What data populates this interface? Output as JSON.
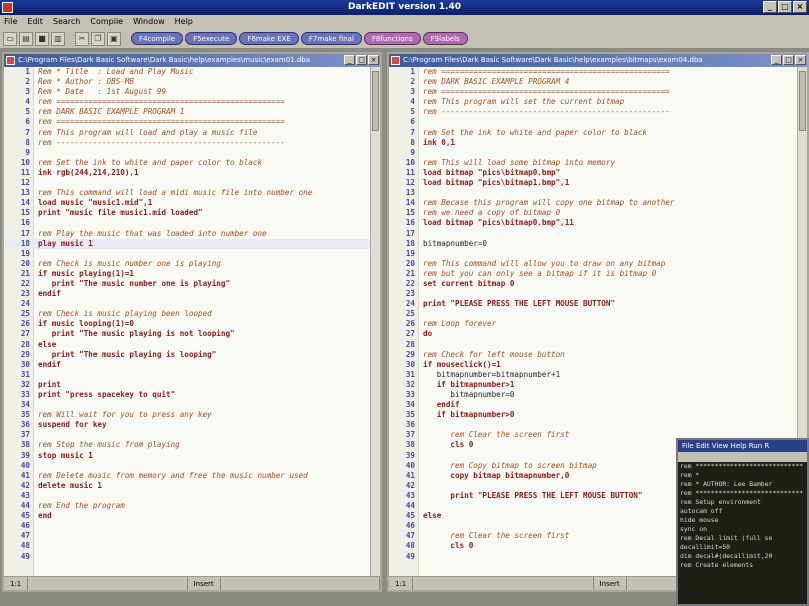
{
  "app": {
    "title": "DarkEDIT version 1.40"
  },
  "menu": [
    "File",
    "Edit",
    "Search",
    "Compile",
    "Window",
    "Help"
  ],
  "function_keys": [
    {
      "label": "F4compile",
      "style": "blue"
    },
    {
      "label": "F5execute",
      "style": "blue"
    },
    {
      "label": "F6make EXE",
      "style": "blue"
    },
    {
      "label": "F7make final",
      "style": "blue"
    },
    {
      "label": "F8functions",
      "style": "pink"
    },
    {
      "label": "F9labels",
      "style": "pink"
    }
  ],
  "left_pane": {
    "title": "C:\\Program Files\\Dark Basic Software\\Dark Basic\\help\\examples\\music\\exam01.dba",
    "status": {
      "position": "1:1",
      "mode": "Insert"
    },
    "lines": [
      {
        "n": "1",
        "t": "Rem * Title  : Load and Play Music",
        "k": "rem"
      },
      {
        "n": "2",
        "t": "Rem * Author : DBS-MB",
        "k": "rem"
      },
      {
        "n": "3",
        "t": "Rem * Date   : 1st August 99",
        "k": "rem"
      },
      {
        "n": "4",
        "t": "rem ==================================================",
        "k": "rem"
      },
      {
        "n": "5",
        "t": "rem DARK BASIC EXAMPLE PROGRAM 1",
        "k": "rem"
      },
      {
        "n": "6",
        "t": "rem ==================================================",
        "k": "rem"
      },
      {
        "n": "7",
        "t": "rem This program will load and play a music file",
        "k": "rem"
      },
      {
        "n": "8",
        "t": "rem --------------------------------------------------",
        "k": "rem"
      },
      {
        "n": "9",
        "t": "",
        "k": ""
      },
      {
        "n": "10",
        "t": "rem Set the ink to white and paper color to black",
        "k": "rem"
      },
      {
        "n": "11",
        "t": "ink rgb(244,214,210),1",
        "k": "kw"
      },
      {
        "n": "12",
        "t": "",
        "k": ""
      },
      {
        "n": "13",
        "t": "rem This command will load a midi music file into number one",
        "k": "rem"
      },
      {
        "n": "14",
        "t": "load music \"music1.mid\",1",
        "k": "kw"
      },
      {
        "n": "15",
        "t": "print \"music file music1.mid loaded\"",
        "k": "kw"
      },
      {
        "n": "16",
        "t": "",
        "k": ""
      },
      {
        "n": "17",
        "t": "rem Play the music that was loaded into number one",
        "k": "rem"
      },
      {
        "n": "18",
        "t": "play music 1",
        "k": "kw"
      },
      {
        "n": "19",
        "t": "",
        "k": ""
      },
      {
        "n": "20",
        "t": "rem Check is music number one is playing",
        "k": "rem"
      },
      {
        "n": "21",
        "t": "if music playing(1)=1",
        "k": "kw"
      },
      {
        "n": "22",
        "t": "   print \"The music number one is playing\"",
        "k": "kw"
      },
      {
        "n": "23",
        "t": "endif",
        "k": "kw"
      },
      {
        "n": "24",
        "t": "",
        "k": ""
      },
      {
        "n": "25",
        "t": "rem Check is music playing been looped",
        "k": "rem"
      },
      {
        "n": "26",
        "t": "if music looping(1)=0",
        "k": "kw"
      },
      {
        "n": "27",
        "t": "   print \"The music playing is not looping\"",
        "k": "kw"
      },
      {
        "n": "28",
        "t": "else",
        "k": "kw"
      },
      {
        "n": "29",
        "t": "   print \"The music playing is looping\"",
        "k": "kw"
      },
      {
        "n": "30",
        "t": "endif",
        "k": "kw"
      },
      {
        "n": "31",
        "t": "",
        "k": ""
      },
      {
        "n": "32",
        "t": "print",
        "k": "kw"
      },
      {
        "n": "33",
        "t": "print \"press spacekey to quit\"",
        "k": "kw"
      },
      {
        "n": "34",
        "t": "",
        "k": ""
      },
      {
        "n": "35",
        "t": "rem Will wait for you to press any key",
        "k": "rem"
      },
      {
        "n": "36",
        "t": "suspend for key",
        "k": "kw"
      },
      {
        "n": "37",
        "t": "",
        "k": ""
      },
      {
        "n": "38",
        "t": "rem Stop the music from playing",
        "k": "rem"
      },
      {
        "n": "39",
        "t": "stop music 1",
        "k": "kw"
      },
      {
        "n": "40",
        "t": "",
        "k": ""
      },
      {
        "n": "41",
        "t": "rem Delete music from memory and free the music number used",
        "k": "rem"
      },
      {
        "n": "42",
        "t": "delete music 1",
        "k": "kw"
      },
      {
        "n": "43",
        "t": "",
        "k": ""
      },
      {
        "n": "44",
        "t": "rem End the program",
        "k": "rem"
      },
      {
        "n": "45",
        "t": "end",
        "k": "kw"
      },
      {
        "n": "46",
        "t": "",
        "k": ""
      },
      {
        "n": "47",
        "t": "",
        "k": ""
      },
      {
        "n": "48",
        "t": "",
        "k": ""
      },
      {
        "n": "49",
        "t": "",
        "k": ""
      }
    ]
  },
  "right_pane": {
    "title": "C:\\Program Files\\Dark Basic Software\\Dark Basic\\help\\examples\\bitmaps\\exam04.dba",
    "status": {
      "position": "1:1",
      "mode": "Insert"
    },
    "lines": [
      {
        "n": "1",
        "t": "rem ==================================================",
        "k": "rem"
      },
      {
        "n": "2",
        "t": "rem DARK BASIC EXAMPLE PROGRAM 4",
        "k": "rem"
      },
      {
        "n": "3",
        "t": "rem ==================================================",
        "k": "rem"
      },
      {
        "n": "4",
        "t": "rem This program will set the current bitmap",
        "k": "rem"
      },
      {
        "n": "5",
        "t": "rem --------------------------------------------------",
        "k": "rem"
      },
      {
        "n": "6",
        "t": "",
        "k": ""
      },
      {
        "n": "7",
        "t": "rem Set the ink to white and paper color to black",
        "k": "rem"
      },
      {
        "n": "8",
        "t": "ink 0,1",
        "k": "kw"
      },
      {
        "n": "9",
        "t": "",
        "k": ""
      },
      {
        "n": "10",
        "t": "rem This will load some bitmap into memory",
        "k": "rem"
      },
      {
        "n": "11",
        "t": "load bitmap \"pics\\bitmap0.bmp\"",
        "k": "kw"
      },
      {
        "n": "12",
        "t": "load bitmap \"pics\\bitmap1.bmp\",1",
        "k": "kw"
      },
      {
        "n": "13",
        "t": "",
        "k": ""
      },
      {
        "n": "14",
        "t": "rem Becase this program will copy one bitmap to another",
        "k": "rem"
      },
      {
        "n": "15",
        "t": "rem we need a copy of bitmap 0",
        "k": "rem"
      },
      {
        "n": "16",
        "t": "load bitmap \"pics\\bitmap0.bmp\",11",
        "k": "kw"
      },
      {
        "n": "17",
        "t": "",
        "k": ""
      },
      {
        "n": "18",
        "t": "bitmapnumber=0",
        "k": ""
      },
      {
        "n": "19",
        "t": "",
        "k": ""
      },
      {
        "n": "20",
        "t": "rem This command will allow you to draw on any bitmap",
        "k": "rem"
      },
      {
        "n": "21",
        "t": "rem but you can only see a bitmap if it is bitmap 0",
        "k": "rem"
      },
      {
        "n": "22",
        "t": "set current bitmap 0",
        "k": "kw"
      },
      {
        "n": "23",
        "t": "",
        "k": ""
      },
      {
        "n": "24",
        "t": "print \"PLEASE PRESS THE LEFT MOUSE BUTTON\"",
        "k": "kw"
      },
      {
        "n": "25",
        "t": "",
        "k": ""
      },
      {
        "n": "26",
        "t": "rem Loop forever",
        "k": "rem"
      },
      {
        "n": "27",
        "t": "do",
        "k": "kw"
      },
      {
        "n": "28",
        "t": "",
        "k": ""
      },
      {
        "n": "29",
        "t": "rem Check for left mouse button",
        "k": "rem"
      },
      {
        "n": "30",
        "t": "if mouseclick()=1",
        "k": "kw"
      },
      {
        "n": "31",
        "t": "   bitmapnumber=bitmapnumber+1",
        "k": ""
      },
      {
        "n": "32",
        "t": "   if bitmapnumber>1",
        "k": "kw"
      },
      {
        "n": "33",
        "t": "      bitmapnumber=0",
        "k": ""
      },
      {
        "n": "34",
        "t": "   endif",
        "k": "kw"
      },
      {
        "n": "35",
        "t": "   if bitmapnumber>0",
        "k": "kw"
      },
      {
        "n": "36",
        "t": "",
        "k": ""
      },
      {
        "n": "37",
        "t": "      rem Clear the screen first",
        "k": "rem"
      },
      {
        "n": "38",
        "t": "      cls 0",
        "k": "kw"
      },
      {
        "n": "39",
        "t": "",
        "k": ""
      },
      {
        "n": "40",
        "t": "      rem Copy bitmap to screen bitmap",
        "k": "rem"
      },
      {
        "n": "41",
        "t": "      copy bitmap bitmapnumber,0",
        "k": "kw"
      },
      {
        "n": "42",
        "t": "",
        "k": ""
      },
      {
        "n": "43",
        "t": "      print \"PLEASE PRESS THE LEFT MOUSE BUTTON\"",
        "k": "kw"
      },
      {
        "n": "44",
        "t": "",
        "k": ""
      },
      {
        "n": "45",
        "t": "else",
        "k": "kw"
      },
      {
        "n": "46",
        "t": "",
        "k": ""
      },
      {
        "n": "47",
        "t": "      rem Clear the screen first",
        "k": "rem"
      },
      {
        "n": "48",
        "t": "      cls 0",
        "k": "kw"
      },
      {
        "n": "49",
        "t": "",
        "k": ""
      }
    ]
  },
  "overlay_window": {
    "menu": "File Edit View Help Run R",
    "lines": [
      "rem ****************************",
      "rem *",
      "rem * AUTHOR: Lee Bamber",
      "rem ****************************",
      "",
      "rem Setup environment",
      "autocam off",
      "hide mouse",
      "sync on",
      "",
      "rem Decal limit (full se",
      "decallimit=50",
      "dim decal#(decallimit,20",
      "",
      "rem Create elements"
    ]
  }
}
